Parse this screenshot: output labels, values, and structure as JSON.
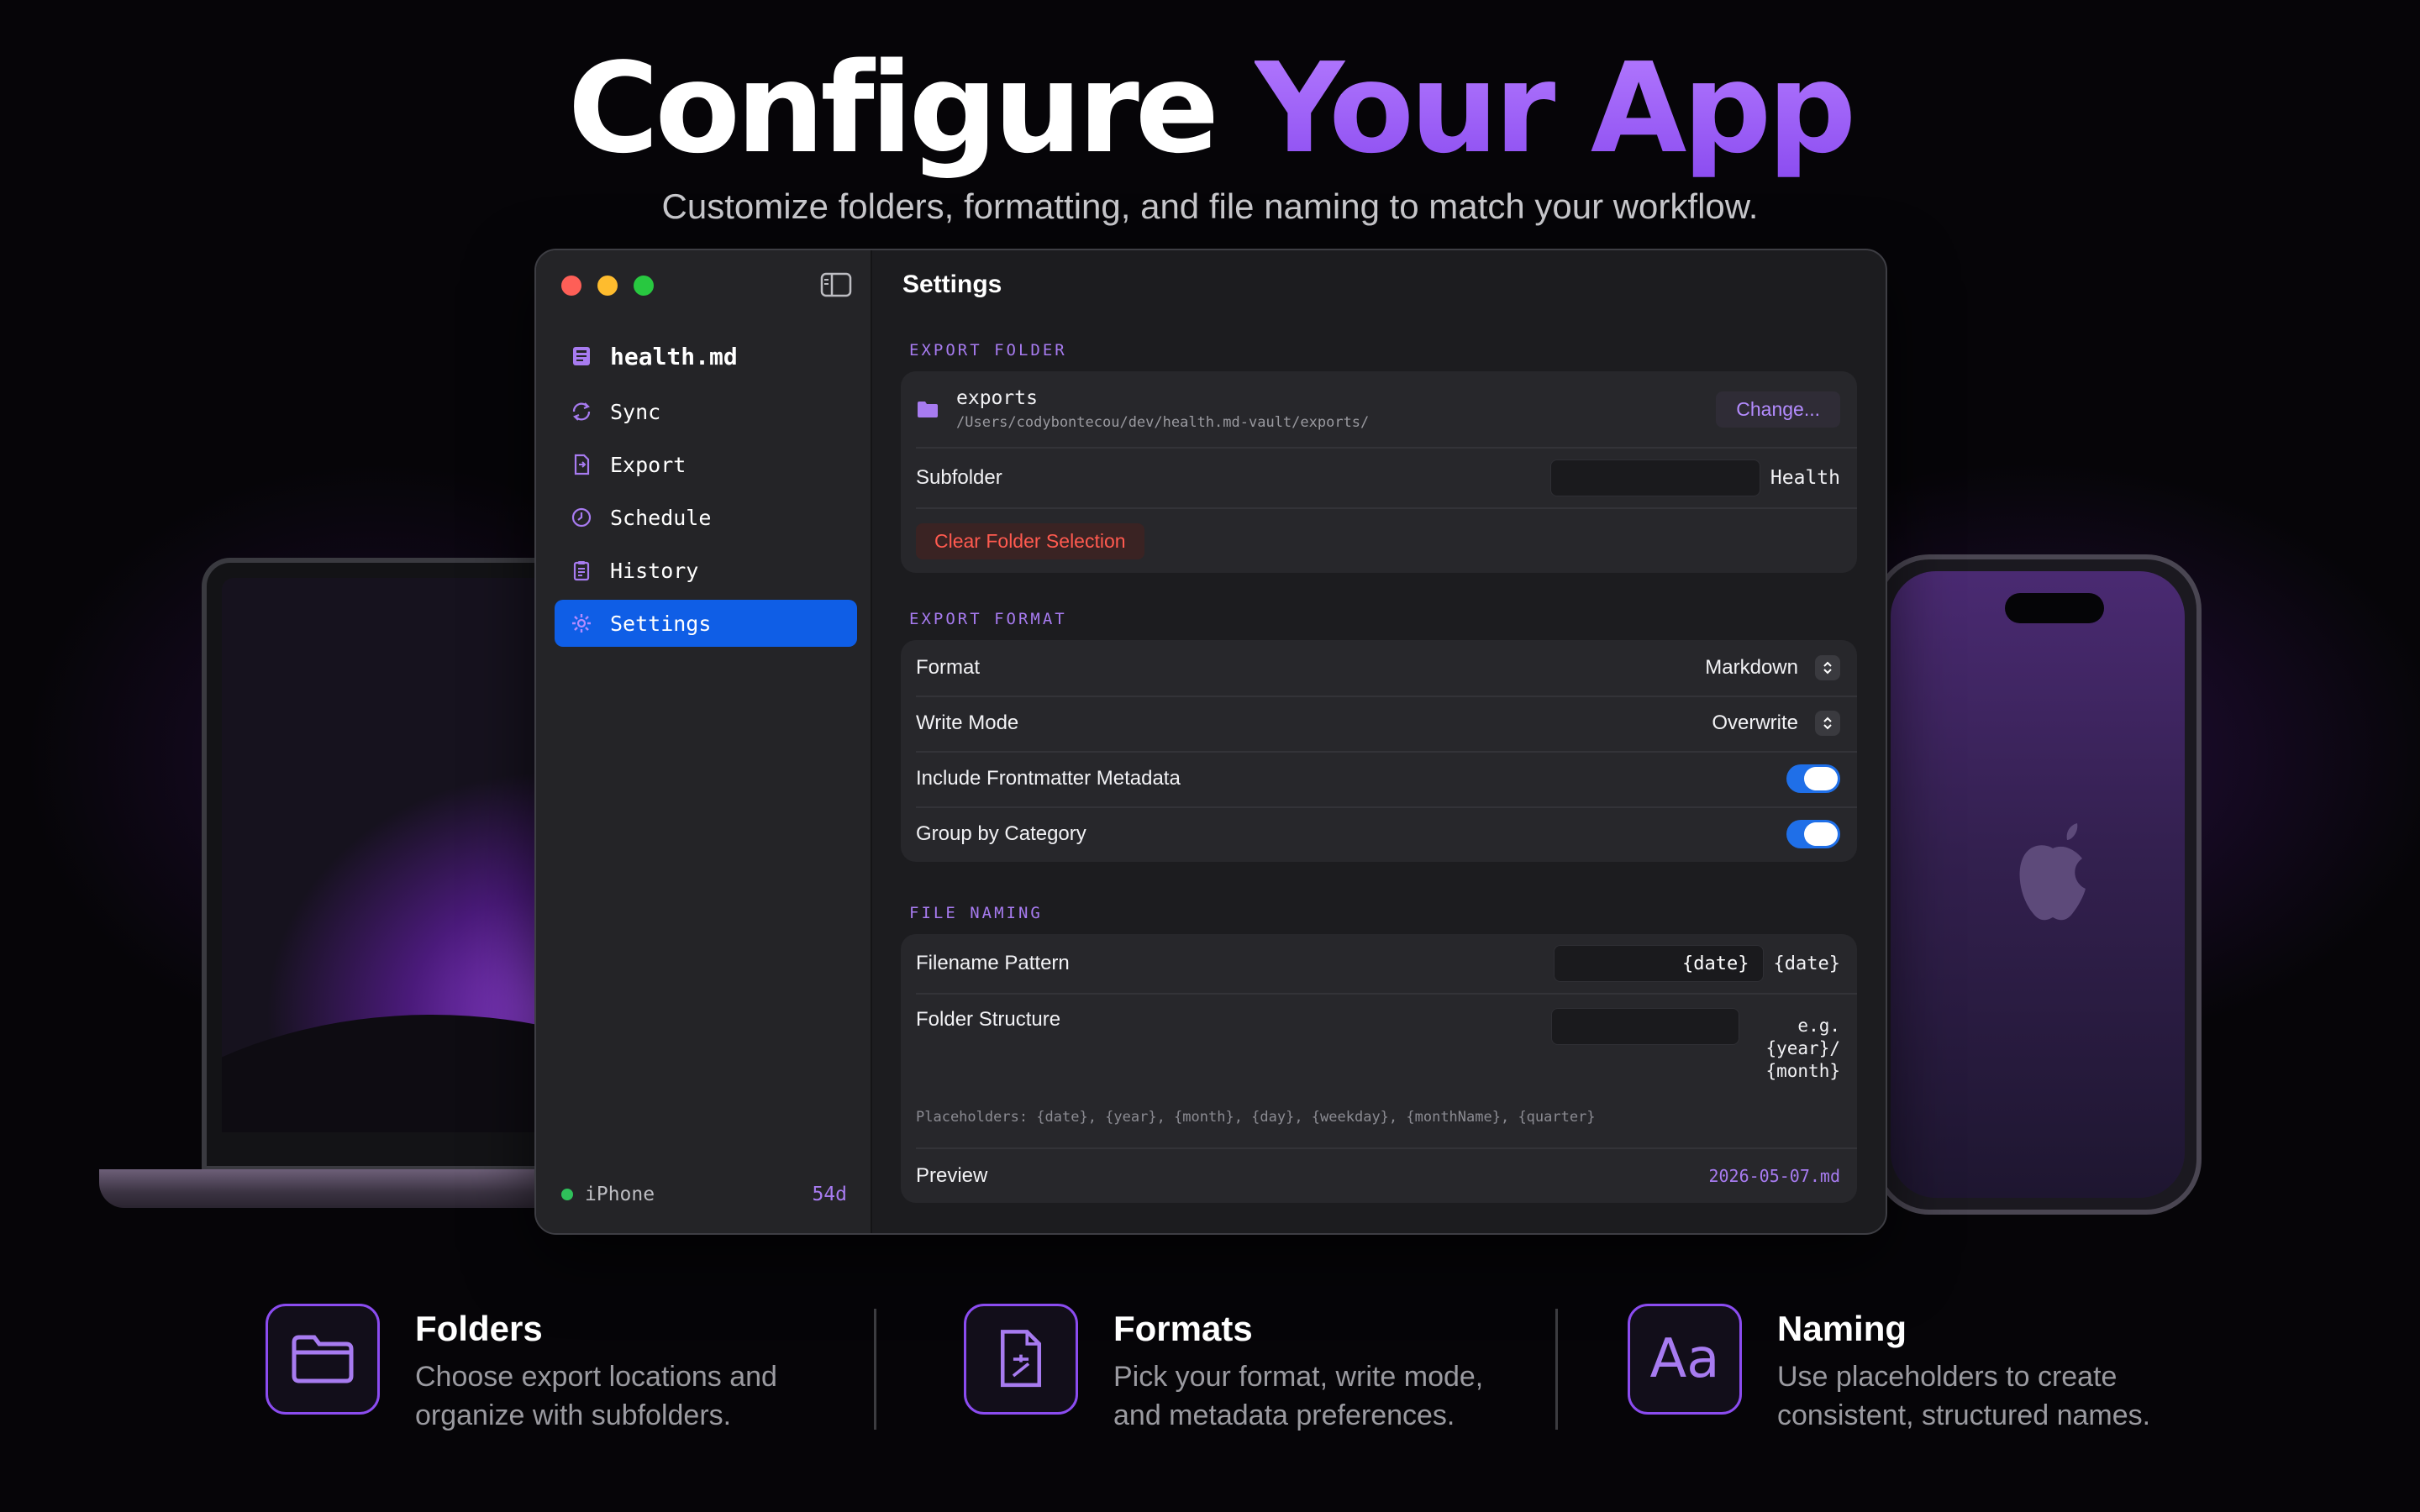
{
  "hero": {
    "title_plain": "Configure",
    "title_accent": "Your App",
    "subtitle": "Customize folders, formatting, and file naming to match your workflow."
  },
  "colors": {
    "accent": "#a77bf0",
    "selection": "#0f5ee6",
    "toggle_on": "#1f6fe8",
    "destructive": "#ff5a4f"
  },
  "sidebar": {
    "app_name": "health.md",
    "items": [
      {
        "label": "Sync",
        "icon": "sync-icon"
      },
      {
        "label": "Export",
        "icon": "export-document-icon"
      },
      {
        "label": "Schedule",
        "icon": "clock-icon"
      },
      {
        "label": "History",
        "icon": "clipboard-icon"
      },
      {
        "label": "Settings",
        "icon": "gear-icon",
        "selected": true
      }
    ],
    "device": {
      "name": "iPhone",
      "age": "54d",
      "status": "connected"
    }
  },
  "settings": {
    "title": "Settings",
    "export_folder": {
      "section_label": "EXPORT FOLDER",
      "folder_name": "exports",
      "folder_path": "/Users/codybontecou/dev/health.md-vault/exports/",
      "change_label": "Change...",
      "subfolder_label": "Subfolder",
      "subfolder_value": "Health",
      "clear_label": "Clear Folder Selection"
    },
    "export_format": {
      "section_label": "EXPORT FORMAT",
      "format_label": "Format",
      "format_value": "Markdown",
      "write_mode_label": "Write Mode",
      "write_mode_value": "Overwrite",
      "frontmatter_label": "Include Frontmatter Metadata",
      "frontmatter_on": true,
      "group_label": "Group by Category",
      "group_on": true
    },
    "file_naming": {
      "section_label": "FILE NAMING",
      "filename_label": "Filename Pattern",
      "filename_field": "{date}",
      "filename_value": "{date}",
      "folder_structure_label": "Folder Structure",
      "folder_structure_line1": "e.g.",
      "folder_structure_line2": "{year}/",
      "folder_structure_line3": "{month}",
      "placeholders_hint": "Placeholders: {date}, {year}, {month}, {day}, {weekday}, {monthName}, {quarter}",
      "preview_label": "Preview",
      "preview_value": "2026-05-07.md"
    }
  },
  "features": [
    {
      "title": "Folders",
      "line1": "Choose export locations and",
      "line2": "organize with subfolders.",
      "icon": "folder-icon"
    },
    {
      "title": "Formats",
      "line1": "Pick your format, write mode,",
      "line2": "and metadata preferences.",
      "icon": "document-format-icon"
    },
    {
      "title": "Naming",
      "line1": "Use placeholders to create",
      "line2": "consistent, structured names.",
      "icon_text": "Aa",
      "icon": "text-aa-icon"
    }
  ]
}
